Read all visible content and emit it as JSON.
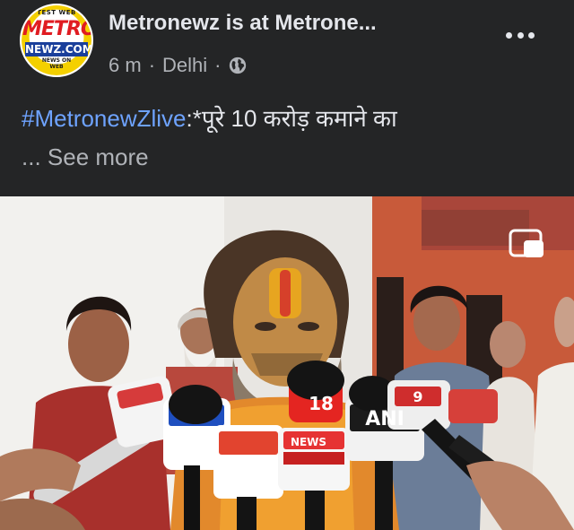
{
  "post": {
    "page_name": "Metronewz is at Metrone...",
    "time": "6 m",
    "separator": "·",
    "location": "Delhi",
    "audience_icon": "globe-icon",
    "hashtag": "#MetronewZlive",
    "text": ":*पूरे 10 करोड़ कमाने का",
    "see_more": "... See more"
  },
  "avatar": {
    "top": "TEST WEB",
    "main": "METRO",
    "sub": "NEWZ.COM",
    "bottom": "NEWS ON WEB"
  },
  "media": {
    "mic_labels": [
      "18",
      "ANI",
      "NEWS",
      "9"
    ],
    "pip_icon": "picture-in-picture-icon"
  },
  "colors": {
    "background": "#242526",
    "text": "#e4e6eb",
    "secondary": "#b0b3b8",
    "hashtag": "#6ea3ff"
  }
}
